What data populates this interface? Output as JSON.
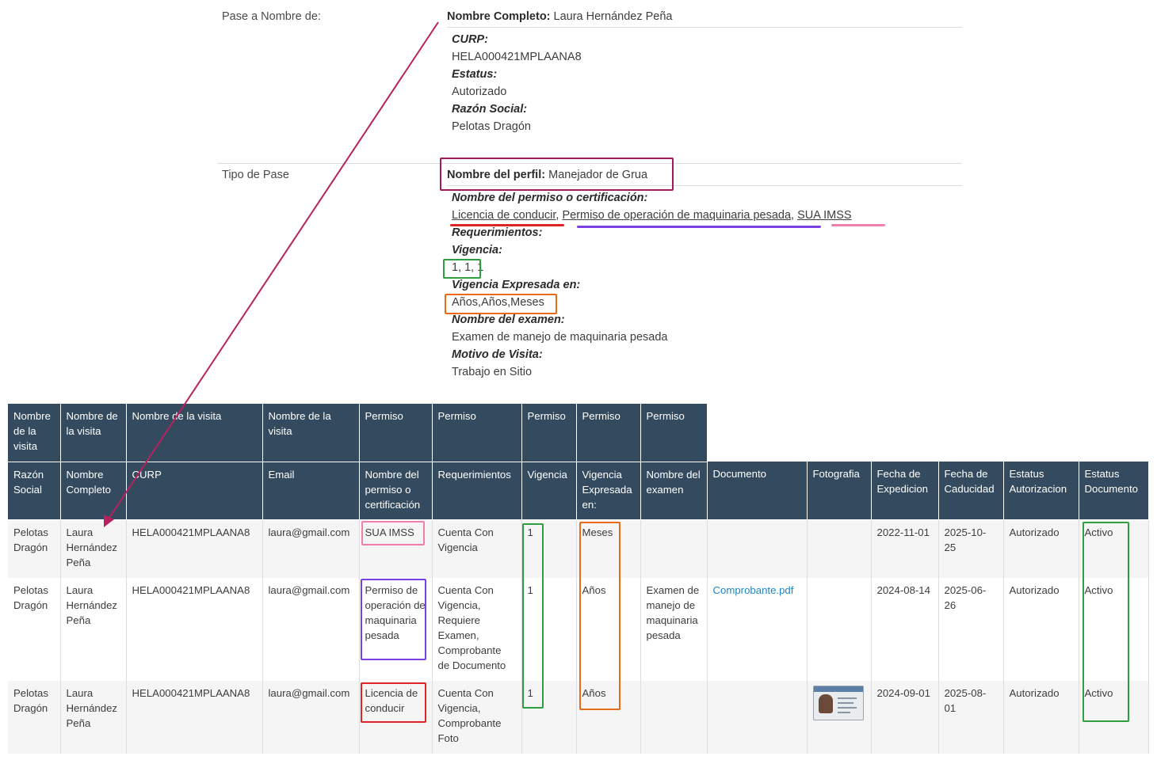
{
  "pase": {
    "label": "Pase a Nombre de:",
    "nombre_label": "Nombre Completo:",
    "nombre_value": "Laura Hernández Peña",
    "curp_label": "CURP:",
    "curp_value": "HELA000421MPLAANA8",
    "estatus_label": "Estatus:",
    "estatus_value": "Autorizado",
    "razon_label": "Razón Social:",
    "razon_value": "Pelotas Dragón"
  },
  "tipo": {
    "label": "Tipo de Pase",
    "perfil_label": "Nombre del perfil:",
    "perfil_value": "Manejador de Grua",
    "permiso_label": "Nombre del permiso o certificación:",
    "permisos": [
      "Licencia de conducir",
      "Permiso de operación de maquinaria pesada",
      "SUA IMSS"
    ],
    "sep": ", ",
    "req_label": "Requerimientos:",
    "vigencia_label": "Vigencia:",
    "vigencia_value": "1, 1, 1",
    "vig_exp_label": "Vigencia Expresada en:",
    "vig_exp_value": "Años,Años,Meses",
    "examen_label": "Nombre del examen:",
    "examen_value": "Examen de manejo de maquinaria pesada",
    "motivo_label": "Motivo de Visita:",
    "motivo_value": "Trabajo en Sitio"
  },
  "table": {
    "group_headers": [
      "Nombre de la visita",
      "Nombre de la visita",
      "Nombre de la visita",
      "Nombre de la visita",
      "Permiso",
      "Permiso",
      "Permiso",
      "Permiso",
      "Permiso"
    ],
    "headers": [
      "Razón Social",
      "Nombre Completo",
      "CURP",
      "Email",
      "Nombre del permiso o certificación",
      "Requerimientos",
      "Vigencia",
      "Vigencia Expresada en:",
      "Nombre del examen",
      "Documento",
      "Fotografia",
      "Fecha de Expedicion",
      "Fecha de Caducidad",
      "Estatus Autorizacion",
      "Estatus Documento"
    ],
    "rows": [
      {
        "razon": "Pelotas Dragón",
        "nombre": "Laura Hernández Peña",
        "curp": "HELA000421MPLAANA8",
        "email": "laura@gmail.com",
        "permiso": "SUA IMSS",
        "req": "Cuenta Con Vigencia",
        "vigencia": "1",
        "vig_exp": "Meses",
        "examen": "",
        "documento": "",
        "foto": "",
        "expedicion": "2022-11-01",
        "caducidad": "2025-10-25",
        "est_aut": "Autorizado",
        "est_doc": "Activo"
      },
      {
        "razon": "Pelotas Dragón",
        "nombre": "Laura Hernández Peña",
        "curp": "HELA000421MPLAANA8",
        "email": "laura@gmail.com",
        "permiso": "Permiso de operación de maquinaria pesada",
        "req": "Cuenta Con Vigencia, Requiere Examen, Comprobante de Documento",
        "vigencia": "1",
        "vig_exp": "Años",
        "examen": "Examen de manejo de maquinaria pesada",
        "documento": "Comprobante.pdf",
        "foto": "",
        "expedicion": "2024-08-14",
        "caducidad": "2025-06-26",
        "est_aut": "Autorizado",
        "est_doc": "Activo"
      },
      {
        "razon": "Pelotas Dragón",
        "nombre": "Laura Hernández Peña",
        "curp": "HELA000421MPLAANA8",
        "email": "laura@gmail.com",
        "permiso": "Licencia de conducir",
        "req": "Cuenta Con Vigencia, Comprobante Foto",
        "vigencia": "1",
        "vig_exp": "Años",
        "examen": "",
        "documento": "",
        "foto": "id-card-photo",
        "expedicion": "2024-09-01",
        "caducidad": "2025-08-01",
        "est_aut": "Autorizado",
        "est_doc": "Activo"
      }
    ]
  },
  "annotation_colors": {
    "arrow": "#b5225f",
    "perfil_box": "#a3195b",
    "licencia": "#e02424",
    "permiso": "#7b3fe4",
    "sua": "#ef7fae",
    "vigencia": "#2e9e3e",
    "vig_exp": "#ea6a1c",
    "estatus": "#2e9e3e"
  }
}
